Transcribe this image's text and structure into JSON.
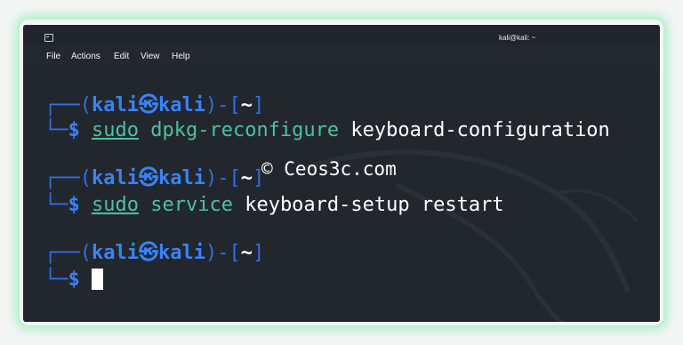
{
  "window": {
    "title": "kali@kali: ~"
  },
  "menu": {
    "items": [
      "File",
      "Actions",
      "Edit",
      "View",
      "Help"
    ]
  },
  "terminal": {
    "prompts": [
      {
        "box_top": "┌──(",
        "user": "kali",
        "skull": "㉿",
        "host": "kali",
        "mid": ")-[",
        "dir": "~",
        "end": "]",
        "box_bottom": "└─",
        "dollar": "$",
        "cmd_sudo": "sudo",
        "cmd_rest_teal": "dpkg-reconfigure",
        "cmd_rest_white": "keyboard-configuration"
      },
      {
        "box_top": "┌──(",
        "user": "kali",
        "skull": "㉿",
        "host": "kali",
        "mid": ")-[",
        "dir": "~",
        "end": "]",
        "box_bottom": "└─",
        "dollar": "$",
        "cmd_sudo": "sudo",
        "cmd_rest_teal": "service",
        "cmd_rest_white": "keyboard-setup restart"
      },
      {
        "box_top": "┌──(",
        "user": "kali",
        "skull": "㉿",
        "host": "kali",
        "mid": ")-[",
        "dir": "~",
        "end": "]",
        "box_bottom": "└─",
        "dollar": "$"
      }
    ]
  },
  "watermark": {
    "text": "© Ceos3c.com"
  },
  "colors": {
    "background": "#22272e",
    "prompt_blue": "#3b82f6",
    "command_teal": "#4fbfa3",
    "frame_glow": "#b8f0cf"
  }
}
